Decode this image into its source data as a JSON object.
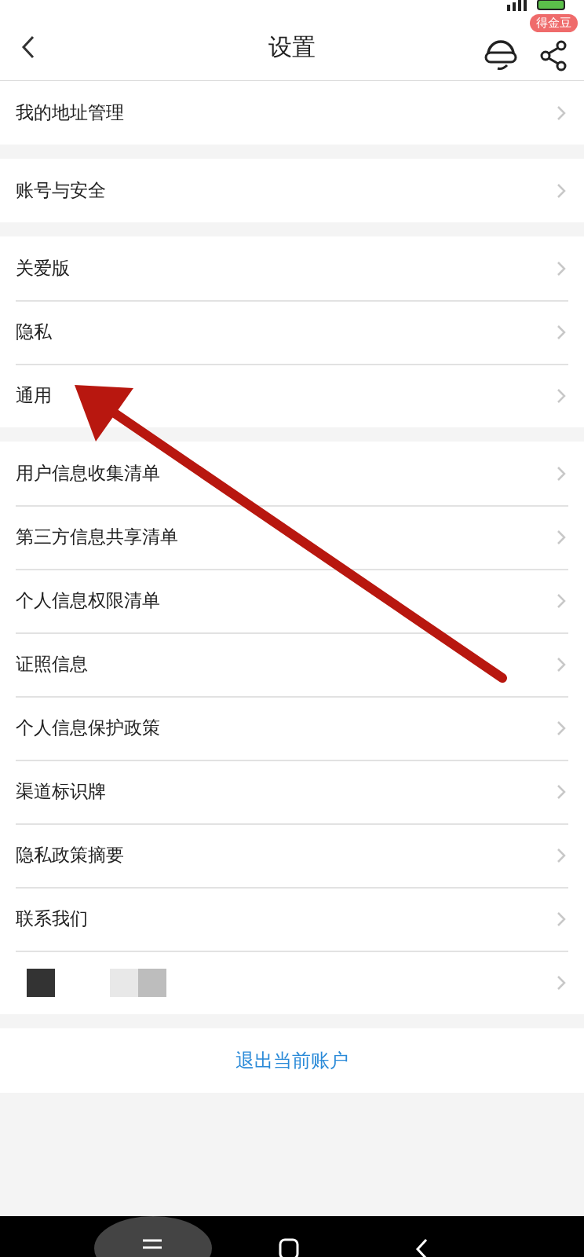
{
  "header": {
    "title": "设置",
    "badge": "得金豆"
  },
  "groups": [
    {
      "items": [
        {
          "kind": "text",
          "label": "我的地址管理"
        }
      ]
    },
    {
      "items": [
        {
          "kind": "text",
          "label": "账号与安全"
        }
      ]
    },
    {
      "items": [
        {
          "kind": "text",
          "label": "关爱版"
        },
        {
          "kind": "text",
          "label": "隐私"
        },
        {
          "kind": "text",
          "label": "通用"
        }
      ]
    },
    {
      "items": [
        {
          "kind": "text",
          "label": "用户信息收集清单"
        },
        {
          "kind": "text",
          "label": "第三方信息共享清单"
        },
        {
          "kind": "text",
          "label": "个人信息权限清单"
        },
        {
          "kind": "text",
          "label": "证照信息"
        },
        {
          "kind": "text",
          "label": "个人信息保护政策"
        },
        {
          "kind": "text",
          "label": "渠道标识牌"
        },
        {
          "kind": "text",
          "label": "隐私政策摘要"
        },
        {
          "kind": "text",
          "label": "联系我们"
        },
        {
          "kind": "redacted"
        }
      ]
    }
  ],
  "logout": "退出当前账户"
}
